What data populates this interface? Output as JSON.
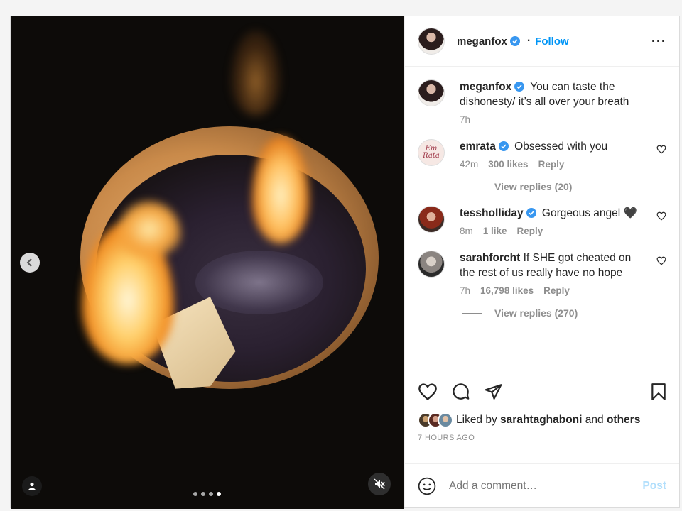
{
  "post": {
    "author": "meganfox",
    "separator": "·",
    "follow_label": "Follow",
    "more_label": "···",
    "carousel": {
      "current_index": 4,
      "total": 4
    }
  },
  "caption": {
    "username": "meganfox",
    "text": "You can taste the dishonesty/ it’s all over your breath",
    "time": "7h"
  },
  "comments": [
    {
      "username": "emrata",
      "verified": true,
      "text": "Obsessed with you",
      "time": "42m",
      "likes": "300 likes",
      "reply_label": "Reply",
      "view_replies": "View replies (20)",
      "avatar_text": [
        "Em",
        "Rata"
      ]
    },
    {
      "username": "tessholliday",
      "verified": true,
      "text": "Gorgeous angel 🖤",
      "time": "8m",
      "likes": "1 like",
      "reply_label": "Reply"
    },
    {
      "username": "sarahforcht",
      "verified": false,
      "text": "If SHE got cheated on the rest of us really have no hope",
      "time": "7h",
      "likes": "16,798 likes",
      "reply_label": "Reply",
      "view_replies": "View replies (270)"
    }
  ],
  "likes": {
    "prefix": "Liked by ",
    "user": "sarahtaghaboni",
    "middle": " and ",
    "others": "others"
  },
  "time_ago": "7 HOURS AGO",
  "comment_box": {
    "placeholder": "Add a comment…",
    "post_label": "Post"
  },
  "colors": {
    "accent": "#0095f6",
    "verified": "#3897f0",
    "muted": "#8e8e8e",
    "post_disabled": "#b2dffc"
  },
  "icons": [
    "chevron-left-icon",
    "user-tag-icon",
    "mute-icon",
    "verified-icon",
    "more-icon",
    "heart-icon",
    "comment-icon",
    "share-icon",
    "bookmark-icon",
    "emoji-icon"
  ]
}
